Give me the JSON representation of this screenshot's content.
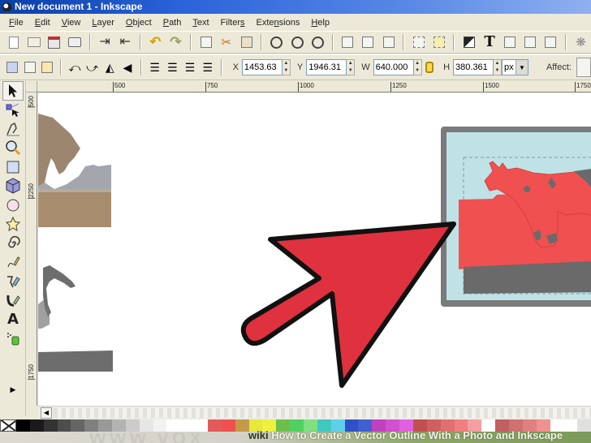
{
  "window": {
    "title": "New document 1 - Inkscape"
  },
  "menubar": {
    "items": [
      {
        "label": "File",
        "u": "F"
      },
      {
        "label": "Edit",
        "u": "E"
      },
      {
        "label": "View",
        "u": "V"
      },
      {
        "label": "Layer",
        "u": "L"
      },
      {
        "label": "Object",
        "u": "O"
      },
      {
        "label": "Path",
        "u": "P"
      },
      {
        "label": "Text",
        "u": "T"
      },
      {
        "label": "Filters",
        "u": "s"
      },
      {
        "label": "Extensions",
        "u": "n"
      },
      {
        "label": "Help",
        "u": "H"
      }
    ]
  },
  "commands_bar": {
    "icons": [
      "new-document-icon",
      "open-icon",
      "save-icon",
      "print-icon",
      "import-icon",
      "export-icon",
      "undo-icon",
      "redo-icon",
      "duplicate-icon",
      "cut-icon",
      "paste-icon",
      "zoom-selection-icon",
      "zoom-drawing-icon",
      "zoom-page-icon",
      "group-icon",
      "ungroup-icon",
      "clone-icon",
      "node-editor-icon",
      "snap-icon",
      "fill-stroke-icon",
      "text-tool-icon",
      "layers-icon",
      "xml-editor-icon",
      "align-icon",
      "preferences-icon"
    ]
  },
  "tool_controls": {
    "x": {
      "label": "X",
      "value": "1453.63"
    },
    "y": {
      "label": "Y",
      "value": "1946.31"
    },
    "w": {
      "label": "W",
      "value": "640.000"
    },
    "h": {
      "label": "H",
      "value": "380.361"
    },
    "unit": "px",
    "affect_label": "Affect:"
  },
  "rulers": {
    "horizontal": [
      "500",
      "750",
      "1000",
      "1250",
      "1500",
      "1750"
    ],
    "vertical": [
      "500",
      "2250",
      "1750"
    ]
  },
  "toolbox": {
    "tools": [
      "selector-tool",
      "node-tool",
      "tweak-tool",
      "zoom-tool",
      "rectangle-tool",
      "3d-box-tool",
      "ellipse-tool",
      "star-tool",
      "spiral-tool",
      "pencil-tool",
      "pen-tool",
      "calligraphy-tool",
      "text-tool",
      "spray-tool"
    ],
    "active": "selector-tool"
  },
  "palette": {
    "colors": [
      "#000000",
      "#1a1a1a",
      "#333333",
      "#4d4d4d",
      "#666666",
      "#808080",
      "#999999",
      "#b3b3b3",
      "#cccccc",
      "#e6e6e6",
      "#f2f2f2",
      "#ffffff",
      "#ffffff",
      "#ffffff",
      "#e35a5a",
      "#f05050",
      "#c49a4a",
      "#e8e83a",
      "#f0f040",
      "#6cc04a",
      "#50d060",
      "#80e080",
      "#40c8c0",
      "#60d0e8",
      "#3050c8",
      "#4060d0",
      "#c040c0",
      "#d050d0",
      "#e060e0",
      "#c05050",
      "#d06060",
      "#e07070",
      "#f08080",
      "#f4a0a0",
      "#ffffff",
      "#c06060",
      "#d07070",
      "#e08080",
      "#f09090",
      "#ffffff",
      "#ffffff",
      "#e0e0e0"
    ]
  },
  "watermark": {
    "brand_prefix": "wiki",
    "brand_suffix": "How",
    "text": "How to Create a Vector Outline With a Photo and Inkscape",
    "big_text": "WWW.VOX"
  },
  "colors": {
    "arrow_fill": "#e0313f",
    "fox_fill": "#f05050",
    "frame_bg": "#bfe2e6",
    "frame_border": "#777777"
  }
}
